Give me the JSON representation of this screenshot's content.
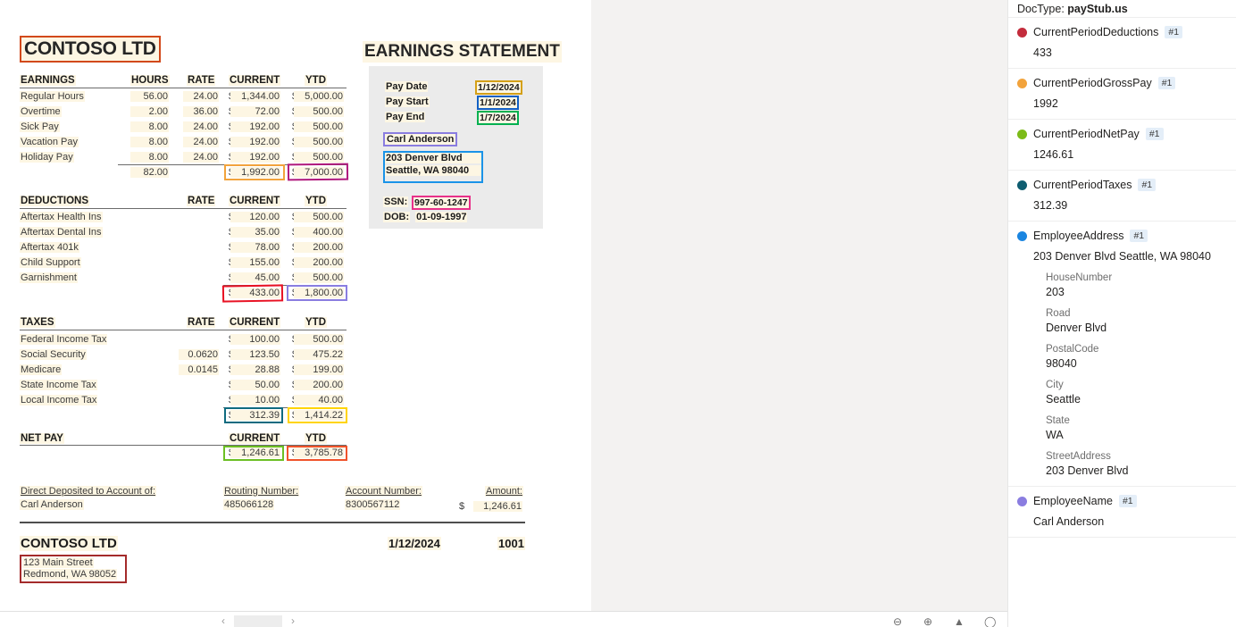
{
  "document": {
    "company_title": "CONTOSO LTD",
    "statement_title": "EARNINGS STATEMENT",
    "info": {
      "pay_date_label": "Pay Date",
      "pay_date_value": "1/12/2024",
      "pay_start_label": "Pay Start",
      "pay_start_value": "1/1/2024",
      "pay_end_label": "Pay End",
      "pay_end_value": "1/7/2024",
      "employee_name": "Carl Anderson",
      "address_line1": "203 Denver Blvd",
      "address_line2": "Seattle, WA 98040",
      "ssn_label": "SSN:",
      "ssn_value": "997-60-1247",
      "dob_label": "DOB:",
      "dob_value": "01-09-1997"
    },
    "earnings": {
      "title": "EARNINGS",
      "columns": [
        "HOURS",
        "RATE",
        "CURRENT",
        "YTD"
      ],
      "rows": [
        {
          "name": "Regular Hours",
          "hours": "56.00",
          "rate": "24.00",
          "current": "1,344.00",
          "ytd": "5,000.00"
        },
        {
          "name": "Overtime",
          "hours": "2.00",
          "rate": "36.00",
          "current": "72.00",
          "ytd": "500.00"
        },
        {
          "name": "Sick Pay",
          "hours": "8.00",
          "rate": "24.00",
          "current": "192.00",
          "ytd": "500.00"
        },
        {
          "name": "Vacation Pay",
          "hours": "8.00",
          "rate": "24.00",
          "current": "192.00",
          "ytd": "500.00"
        },
        {
          "name": "Holiday Pay",
          "hours": "8.00",
          "rate": "24.00",
          "current": "192.00",
          "ytd": "500.00"
        }
      ],
      "total_hours": "82.00",
      "total_current": "1,992.00",
      "total_ytd": "7,000.00"
    },
    "deductions": {
      "title": "DEDUCTIONS",
      "columns": [
        "RATE",
        "CURRENT",
        "YTD"
      ],
      "rows": [
        {
          "name": "Aftertax Health Ins",
          "rate": "",
          "current": "120.00",
          "ytd": "500.00"
        },
        {
          "name": "Aftertax Dental Ins",
          "rate": "",
          "current": "35.00",
          "ytd": "400.00"
        },
        {
          "name": "Aftertax 401k",
          "rate": "",
          "current": "78.00",
          "ytd": "200.00"
        },
        {
          "name": "Child Support",
          "rate": "",
          "current": "155.00",
          "ytd": "200.00"
        },
        {
          "name": "Garnishment",
          "rate": "",
          "current": "45.00",
          "ytd": "500.00"
        }
      ],
      "total_current": "433.00",
      "total_ytd": "1,800.00"
    },
    "taxes": {
      "title": "TAXES",
      "columns": [
        "RATE",
        "CURRENT",
        "YTD"
      ],
      "rows": [
        {
          "name": "Federal Income Tax",
          "rate": "",
          "current": "100.00",
          "ytd": "500.00"
        },
        {
          "name": "Social Security",
          "rate": "0.0620",
          "current": "123.50",
          "ytd": "475.22"
        },
        {
          "name": "Medicare",
          "rate": "0.0145",
          "current": "28.88",
          "ytd": "199.00"
        },
        {
          "name": "State Income Tax",
          "rate": "",
          "current": "50.00",
          "ytd": "200.00"
        },
        {
          "name": "Local Income Tax",
          "rate": "",
          "current": "10.00",
          "ytd": "40.00"
        }
      ],
      "total_current": "312.39",
      "total_ytd": "1,414.22"
    },
    "netpay": {
      "title": "NET PAY",
      "columns": [
        "CURRENT",
        "YTD"
      ],
      "current": "1,246.61",
      "ytd": "3,785.78"
    },
    "deposit": {
      "account_of_label": "Direct Deposited to Account of:",
      "account_of_value": "Carl Anderson",
      "routing_label": "Routing Number:",
      "routing_value": "485066128",
      "account_label": "Account Number:",
      "account_value": "8300567112",
      "amount_label": "Amount:",
      "amount_value": "1,246.61"
    },
    "footer": {
      "company": "CONTOSO LTD",
      "address_line1": "123 Main Street",
      "address_line2": "Redmond, WA 98052",
      "date": "1/12/2024",
      "check_number": "1001"
    },
    "dollar_sign": "$"
  },
  "overlay_colors": {
    "company_title": "#d2491b",
    "gross_current": "#f2a33c",
    "gross_ytd": "#b0197c",
    "deduct_current": "#e81123",
    "deduct_ytd": "#8a7de0",
    "tax_current": "#106b80",
    "tax_ytd": "#ffd400",
    "net_current": "#6cbf24",
    "net_ytd": "#f0532a",
    "pay_date": "#d4a017",
    "pay_start": "#1160c4",
    "pay_end": "#00b050",
    "employee_name": "#8a7de0",
    "employee_address": "#1a93e8",
    "ssn": "#e8308a",
    "footer_address": "#a42b2b"
  },
  "toolbar": {
    "prev_label": "‹",
    "next_label": "›",
    "page_value": "",
    "icons": [
      "zoom-out-icon",
      "zoom-in-icon",
      "fit-page-icon",
      "comment-icon"
    ]
  },
  "sidebar": {
    "doctype_label": "DocType:",
    "doctype_value": "payStub.us",
    "fields": [
      {
        "name": "CurrentPeriodDeductions",
        "badge": "#1",
        "color": "#c32c3c",
        "value": "433",
        "subfields": []
      },
      {
        "name": "CurrentPeriodGrossPay",
        "badge": "#1",
        "color": "#f2a33c",
        "value": "1992",
        "subfields": []
      },
      {
        "name": "CurrentPeriodNetPay",
        "badge": "#1",
        "color": "#7cbb18",
        "value": "1246.61",
        "subfields": []
      },
      {
        "name": "CurrentPeriodTaxes",
        "badge": "#1",
        "color": "#0e5d70",
        "value": "312.39",
        "subfields": []
      },
      {
        "name": "EmployeeAddress",
        "badge": "#1",
        "color": "#1a85e0",
        "value": "203 Denver Blvd Seattle, WA 98040",
        "subfields": [
          {
            "label": "HouseNumber",
            "value": "203"
          },
          {
            "label": "Road",
            "value": "Denver Blvd"
          },
          {
            "label": "PostalCode",
            "value": "98040"
          },
          {
            "label": "City",
            "value": "Seattle"
          },
          {
            "label": "State",
            "value": "WA"
          },
          {
            "label": "StreetAddress",
            "value": "203 Denver Blvd"
          }
        ]
      },
      {
        "name": "EmployeeName",
        "badge": "#1",
        "color": "#8a7de0",
        "value": "Carl Anderson",
        "subfields": []
      }
    ]
  }
}
